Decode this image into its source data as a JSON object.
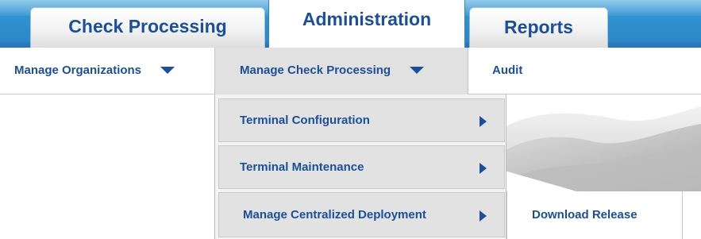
{
  "tabs": [
    {
      "label": "Check Processing",
      "active": false
    },
    {
      "label": "Administration",
      "active": true
    },
    {
      "label": "Reports",
      "active": false
    }
  ],
  "submenu": {
    "manage_organizations": "Manage Organizations",
    "manage_check_processing": "Manage Check Processing",
    "audit": "Audit"
  },
  "dropdown": {
    "items": [
      {
        "label": "Terminal Configuration"
      },
      {
        "label": "Terminal Maintenance"
      },
      {
        "label": "Manage Centralized Deployment"
      }
    ]
  },
  "flyout": {
    "items": [
      {
        "label": "Download Release"
      }
    ]
  },
  "colors": {
    "tab_bar": "#2f8fcf",
    "link_text": "#1a4f9c",
    "menu_bg": "#e1e1e1"
  },
  "icons": {
    "submenu_caret": "chevron-down-icon",
    "dropdown_caret": "chevron-right-icon"
  }
}
